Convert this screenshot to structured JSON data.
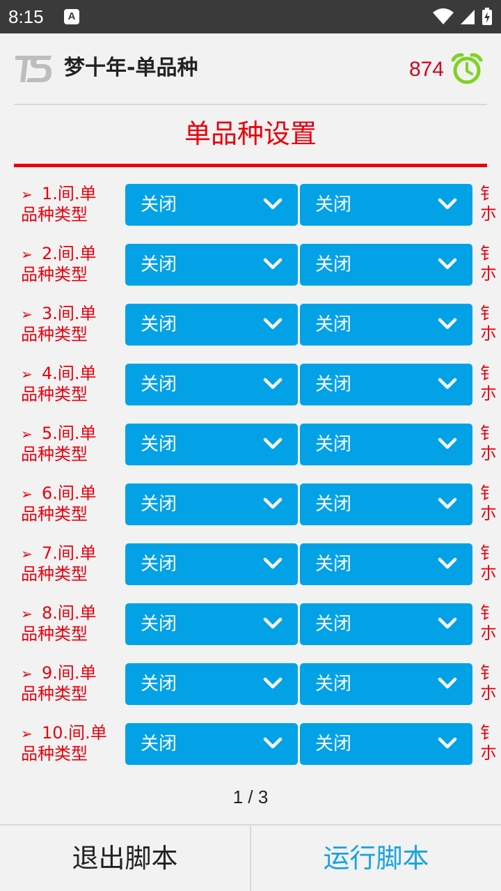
{
  "status_bar": {
    "time": "8:15",
    "notification_icon_letter": "A"
  },
  "header": {
    "title": "梦十年-单品种",
    "counter": "874",
    "counter_color": "#d0021b",
    "alarm_color": "#7ed321"
  },
  "section": {
    "title": "单品种设置",
    "accent_color": "#e8000d"
  },
  "rows": [
    {
      "label_line1": "1.间.单",
      "label_line2": "品种类型",
      "select1": "关闭",
      "select2": "关闭",
      "side_line1": "钅",
      "side_line2": "朩"
    },
    {
      "label_line1": "2.间.单",
      "label_line2": "品种类型",
      "select1": "关闭",
      "select2": "关闭",
      "side_line1": "钅",
      "side_line2": "朩"
    },
    {
      "label_line1": "3.间.单",
      "label_line2": "品种类型",
      "select1": "关闭",
      "select2": "关闭",
      "side_line1": "钅",
      "side_line2": "朩"
    },
    {
      "label_line1": "4.间.单",
      "label_line2": "品种类型",
      "select1": "关闭",
      "select2": "关闭",
      "side_line1": "钅",
      "side_line2": "朩"
    },
    {
      "label_line1": "5.间.单",
      "label_line2": "品种类型",
      "select1": "关闭",
      "select2": "关闭",
      "side_line1": "钅",
      "side_line2": "朩"
    },
    {
      "label_line1": "6.间.单",
      "label_line2": "品种类型",
      "select1": "关闭",
      "select2": "关闭",
      "side_line1": "钅",
      "side_line2": "朩"
    },
    {
      "label_line1": "7.间.单",
      "label_line2": "品种类型",
      "select1": "关闭",
      "select2": "关闭",
      "side_line1": "钅",
      "side_line2": "朩"
    },
    {
      "label_line1": "8.间.单",
      "label_line2": "品种类型",
      "select1": "关闭",
      "select2": "关闭",
      "side_line1": "钅",
      "side_line2": "朩"
    },
    {
      "label_line1": "9.间.单",
      "label_line2": "品种类型",
      "select1": "关闭",
      "select2": "关闭",
      "side_line1": "钅",
      "side_line2": "朩"
    },
    {
      "label_line1": "10.间.单",
      "label_line2": "品种类型",
      "select1": "关闭",
      "select2": "关闭",
      "side_line1": "钅",
      "side_line2": "朩"
    }
  ],
  "pager": {
    "text": "1 / 3"
  },
  "footer": {
    "exit_label": "退出脚本",
    "run_label": "运行脚本"
  },
  "colors": {
    "dropdown_bg": "#03a2e6",
    "run_text": "#1aa3e0"
  }
}
